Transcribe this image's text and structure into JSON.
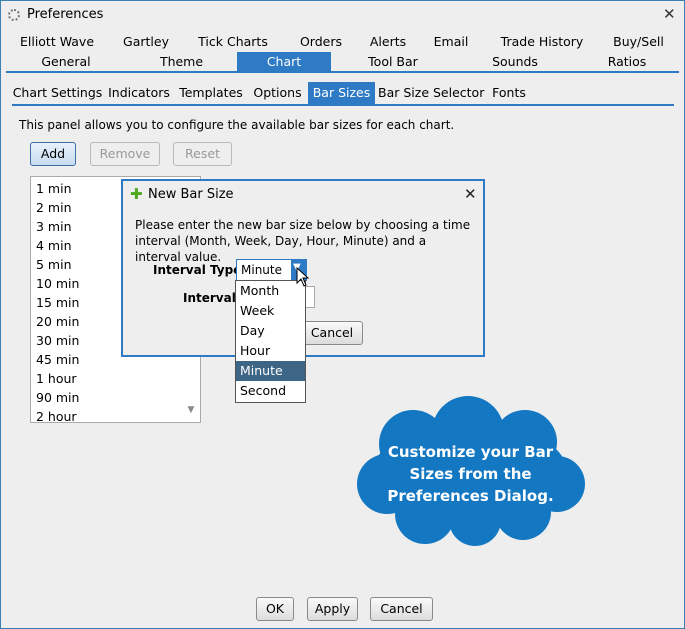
{
  "window": {
    "title": "Preferences"
  },
  "main_tabs_row1": [
    "Elliott Wave",
    "Gartley",
    "Tick Charts",
    "Orders",
    "Alerts",
    "Email",
    "Trade History",
    "Buy/Sell"
  ],
  "main_tabs_row2": [
    "General",
    "Theme",
    "Chart",
    "Tool Bar",
    "Sounds",
    "Ratios"
  ],
  "active_main_tab": "Chart",
  "sub_tabs": [
    "Chart Settings",
    "Indicators",
    "Templates",
    "Options",
    "Bar Sizes",
    "Bar Size Selector",
    "Fonts"
  ],
  "active_sub_tab": "Bar Sizes",
  "panel": {
    "description": "This panel allows you to configure the available bar sizes for each chart.",
    "add_label": "Add",
    "remove_label": "Remove",
    "reset_label": "Reset"
  },
  "bar_sizes": [
    "1 min",
    "2 min",
    "3 min",
    "4 min",
    "5 min",
    "10 min",
    "15 min",
    "20 min",
    "30 min",
    "45 min",
    "1 hour",
    "90 min",
    "2 hour"
  ],
  "dialog": {
    "title": "New Bar Size",
    "text": "Please enter the new bar size below by choosing a time interval (Month, Week, Day, Hour, Minute) and a interval value.",
    "interval_type_label": "Interval Type:",
    "interval_type_value": "Minute",
    "interval_label": "Interval:",
    "cancel_label": "Cancel",
    "options": [
      "Month",
      "Week",
      "Day",
      "Hour",
      "Minute",
      "Second"
    ],
    "selected_option": "Minute"
  },
  "callout": {
    "line1": "Customize your Bar",
    "line2": "Sizes from the",
    "line3": "Preferences Dialog."
  },
  "footer": {
    "ok_label": "OK",
    "apply_label": "Apply",
    "cancel_label": "Cancel"
  },
  "colors": {
    "accent": "#2e7ac4",
    "cloud": "#1477c2",
    "selected": "#3d6585"
  },
  "icons": {
    "title": "gear-icon",
    "dialog": "plus-icon",
    "close": "close-icon",
    "combo": "chevron-down-icon"
  }
}
